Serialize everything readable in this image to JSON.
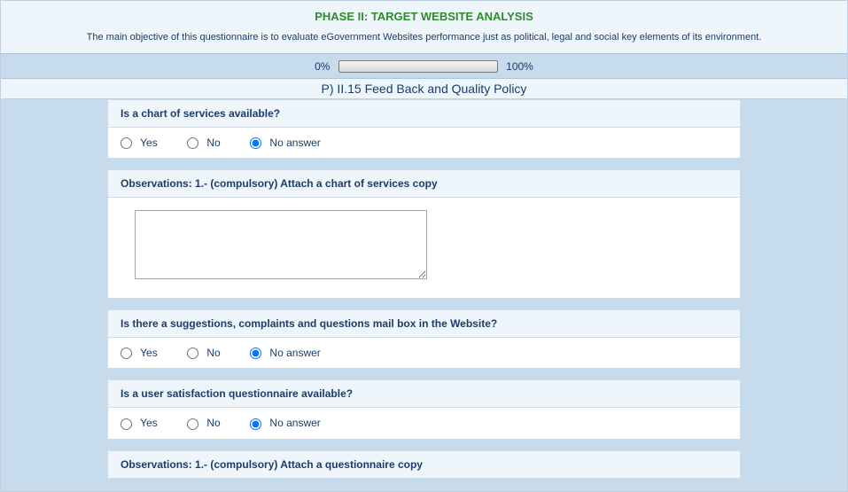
{
  "header": {
    "phase_title": "PHASE II: TARGET WEBSITE ANALYSIS",
    "objective": "The main objective of this questionnaire is to evaluate eGovernment Websites performance just as political, legal and social key elements of its environment."
  },
  "progress": {
    "left_label": "0%",
    "right_label": "100%",
    "value_percent": 0
  },
  "section_title": "P) II.15 Feed Back and Quality Policy",
  "questions": [
    {
      "label": "Is a chart of services available?",
      "options": [
        "Yes",
        "No",
        "No answer"
      ],
      "selected": "No answer"
    },
    {
      "label": "Is there a suggestions, complaints and questions mail box in the Website?",
      "options": [
        "Yes",
        "No",
        "No answer"
      ],
      "selected": "No answer"
    },
    {
      "label": "Is a user satisfaction questionnaire available?",
      "options": [
        "Yes",
        "No",
        "No answer"
      ],
      "selected": "No answer"
    }
  ],
  "observations": [
    {
      "label": "Observations: 1.- (compulsory) Attach a chart of services copy",
      "value": ""
    },
    {
      "label": "Observations: 1.- (compulsory) Attach a questionnaire copy",
      "value": ""
    }
  ]
}
